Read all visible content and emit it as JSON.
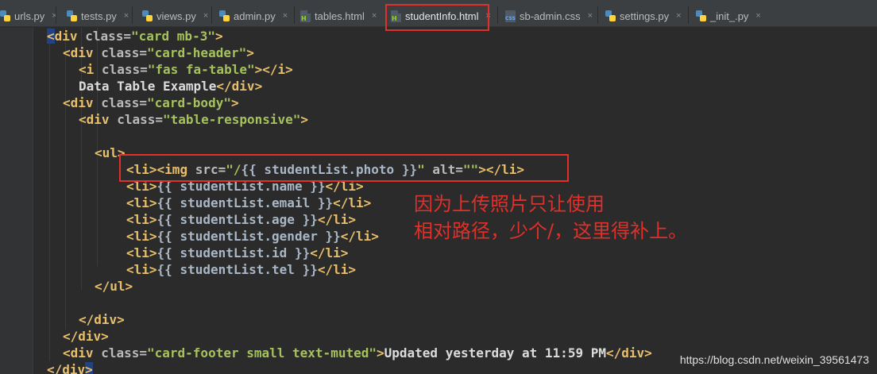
{
  "tabs": [
    {
      "label": "urls.py",
      "type": "py"
    },
    {
      "label": "tests.py",
      "type": "py"
    },
    {
      "label": "views.py",
      "type": "py"
    },
    {
      "label": "admin.py",
      "type": "py"
    },
    {
      "label": "tables.html",
      "type": "html"
    },
    {
      "label": "studentInfo.html",
      "type": "html",
      "active": true
    },
    {
      "label": "sb-admin.css",
      "type": "css"
    },
    {
      "label": "settings.py",
      "type": "py"
    },
    {
      "label": "_init_.py",
      "type": "py"
    }
  ],
  "close_glyph": "×",
  "code": {
    "l1_tag": "div",
    "l1_attr": "class",
    "l1_val": "\"card mb-3\"",
    "l2_tag": "div",
    "l2_attr": "class",
    "l2_val": "\"card-header\"",
    "l3_tag": "i",
    "l3_attr": "class",
    "l3_val": "\"fas fa-table\"",
    "l4_text": "Data Table Example",
    "l4_tag": "div",
    "l5_tag": "div",
    "l5_attr": "class",
    "l5_val": "\"card-body\"",
    "l6_tag": "div",
    "l6_attr": "class",
    "l6_val": "\"table-responsive\"",
    "l8_tag": "ul",
    "l9_li": "li",
    "l9_img": "img",
    "l9_attr1": "src",
    "l9_val1a": "\"/",
    "l9_tpl": "{{ studentList.photo }}",
    "l9_val1b": "\"",
    "l9_attr2": "alt",
    "l9_val2": "\"\"",
    "items": [
      "{{ studentList.name }}",
      "{{ studentList.email }}",
      "{{ studentList.age }}",
      "{{ studentList.gender }}",
      "{{ studentList.id }}",
      "{{ studentList.tel }}"
    ],
    "li_tag": "li",
    "l16_tag": "ul",
    "l18_tag": "div",
    "l19_tag": "div",
    "l20_tag": "div",
    "l20_attr": "class",
    "l20_val": "\"card-footer small text-muted\"",
    "l20_text": "Updated yesterday at 11:59 PM",
    "l21_tag": "div"
  },
  "annotation": {
    "line1": "因为上传照片只让使用",
    "line2": "相对路径，少个/，这里得补上。"
  },
  "watermark": "https://blog.csdn.net/weixin_39561473",
  "colors": {
    "highlight_box": "#e0302a",
    "tag": "#e8bf6a",
    "attr_value": "#a5c25c",
    "background": "#2b2b2b"
  }
}
